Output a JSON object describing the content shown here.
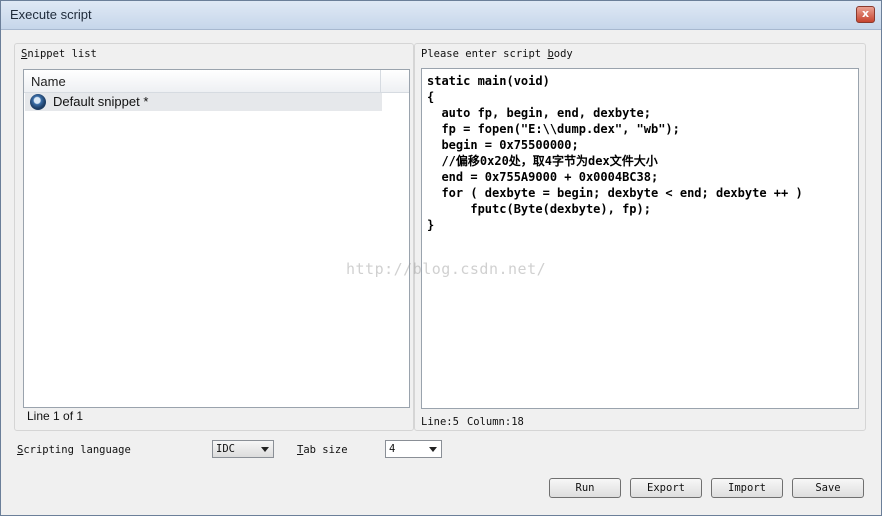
{
  "window": {
    "title": "Execute script",
    "close_label": "x"
  },
  "snippets": {
    "group_label_prefix": "S",
    "group_label_rest": "nippet list",
    "column_header": "Name",
    "items": [
      {
        "label": "Default snippet *",
        "icon": "snippet-icon"
      }
    ],
    "footer": "Line 1 of 1"
  },
  "editor": {
    "group_label_prefix": "Please enter script ",
    "group_label_ul": "b",
    "group_label_rest": "ody",
    "lines": [
      "static main(void)",
      "{",
      "  auto fp, begin, end, dexbyte;",
      "  fp = fopen(\"E:\\\\dump.dex\", \"wb\");",
      "  begin = 0x75500000;",
      "  //偏移0x20处，取4字节为dex文件大小",
      "  end = 0x755A9000 + 0x0004BC38;",
      "  for ( dexbyte = begin; dexbyte < end; dexbyte ++ )",
      "      fputc(Byte(dexbyte), fp);",
      "}"
    ],
    "status_line": "Line:5",
    "status_column": "Column:18"
  },
  "watermark": "http://blog.csdn.net/",
  "settings": {
    "language_label_ul": "S",
    "language_label_rest": "cripting language",
    "language_value": "IDC",
    "tab_label_ul": "T",
    "tab_label_rest": "ab size",
    "tab_value": "4"
  },
  "buttons": {
    "run": "Run",
    "export": "Export",
    "import": "Import",
    "save": "Save"
  }
}
